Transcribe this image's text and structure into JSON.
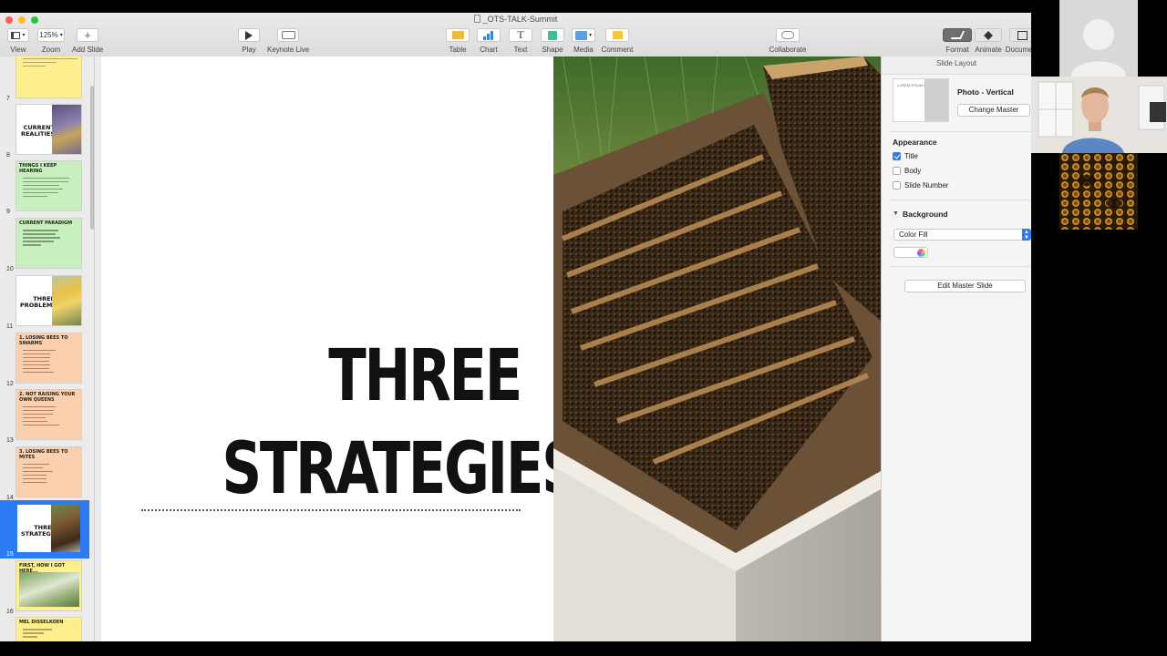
{
  "window": {
    "title": "_OTS-TALK-Summit"
  },
  "toolbar": {
    "view_label": "View",
    "zoom_value": "125%",
    "zoom_label": "Zoom",
    "add_slide_label": "Add Slide",
    "play_label": "Play",
    "keynote_live_label": "Keynote Live",
    "table_label": "Table",
    "chart_label": "Chart",
    "text_label": "Text",
    "shape_label": "Shape",
    "media_label": "Media",
    "comment_label": "Comment",
    "collaborate_label": "Collaborate",
    "format_label": "Format",
    "animate_label": "Animate",
    "document_label": "Document"
  },
  "navigator": {
    "slides": [
      {
        "num": "7",
        "theme": "yellow",
        "title": "",
        "lines": [
          "1 PROBLEMS",
          "2 SOLUTIONS",
          "THREE STRATEGIES THAT HELP YOUR BUSY APIARY",
          "YOUR TURNOVER RATE",
          "WINTERING"
        ]
      },
      {
        "num": "8",
        "theme": "white",
        "big": "CURRENT REALITIES",
        "photo": "purple"
      },
      {
        "num": "9",
        "theme": "green",
        "title": "THINGS I KEEP HEARING",
        "lines": [
          "IT'S HARD KEEPING BEES ALIVE",
          "I'M SPENDING TOO MUCH MONEY",
          "I'M READY TO GIVE UP",
          "I NEED TO GET MORE BEES",
          "IT'S SO FRUSTRATING",
          "I'M OVER IT"
        ]
      },
      {
        "num": "10",
        "theme": "green",
        "title": "CURRENT PARADIGM",
        "lines": [
          "BUY BEES EVERY YEAR",
          "REPLACE DEAD OUTS",
          "BUY PACKAGES AND NUCS",
          "LOSE BEES WINTER",
          "SPRING"
        ]
      },
      {
        "num": "11",
        "theme": "white",
        "big": "THREE PROBLEMS",
        "photo": "flower"
      },
      {
        "num": "12",
        "theme": "salmon",
        "title": "1. LOSING BEES TO SWARMS",
        "lines": [
          "UP TO 60% OF BEES",
          "REDUCED HONEY",
          "LOSS OF QUEEN",
          "LOSS OF BEES",
          "LOSS OF MONEY",
          "LOSS OF TIME",
          "LOSS OF GENETICS"
        ]
      },
      {
        "num": "13",
        "theme": "salmon",
        "title": "2. NOT RAISING YOUR OWN QUEENS",
        "lines": [
          "BUYING EVERY YEAR",
          "GENETICS UNKNOWN",
          "SHIPPING STRESS",
          "EXPENSIVE",
          "NOT ADAPTED",
          "LIMITED AVAILABILITY"
        ]
      },
      {
        "num": "14",
        "theme": "salmon",
        "title": "3. LOSING BEES TO MITES",
        "lines": [
          "VARROA MITES",
          "VIRUSES",
          "COLONY COLLAPSE",
          "TREATMENTS",
          "RESISTANCE",
          "MONITORING"
        ]
      },
      {
        "num": "15",
        "theme": "white",
        "big": "THREE STRATEGIES",
        "photo": "bees",
        "selected": true
      },
      {
        "num": "16",
        "theme": "yellow",
        "title": "FIRST, HOW I GOT HERE...",
        "wide_photo": true
      },
      {
        "num": "",
        "theme": "yellow",
        "title": "MEL DISSELKOEN",
        "lines": [
          "MEL DISSELKOEN",
          "MICHIGAN",
          "OTS"
        ]
      }
    ]
  },
  "slide": {
    "title_line1": "THREE",
    "title_line2": "STRATEGIES"
  },
  "inspector": {
    "header": "Slide Layout",
    "master_name": "Photo - Vertical",
    "master_thumb_text": "LOREM IPSUM DOLOR",
    "change_master_label": "Change Master",
    "appearance_title": "Appearance",
    "title_checkbox": "Title",
    "title_checked": true,
    "body_checkbox": "Body",
    "body_checked": false,
    "slide_number_checkbox": "Slide Number",
    "slide_number_checked": false,
    "background_title": "Background",
    "fill_type": "Color Fill",
    "edit_master_label": "Edit Master Slide"
  },
  "colors": {
    "accent": "#2a7bf5",
    "thumb_yellow": "#fdf08d",
    "thumb_green": "#c9efc0",
    "thumb_salmon": "#fbd0ae"
  }
}
